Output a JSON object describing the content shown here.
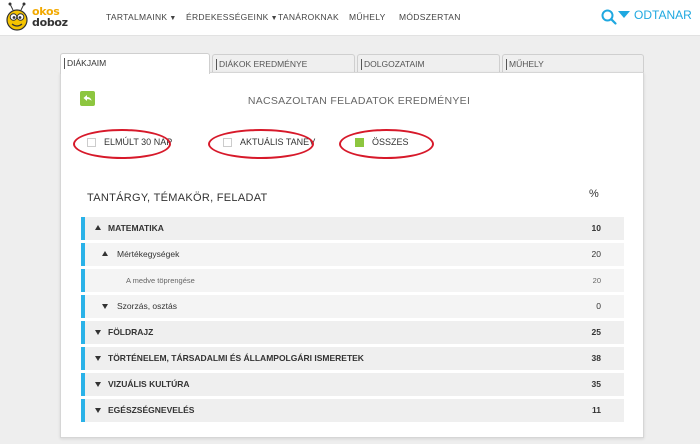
{
  "logo": {
    "line1": "okos",
    "line2": "doboz"
  },
  "nav": [
    {
      "label": "TARTALMAINK",
      "dropdown": true
    },
    {
      "label": "ÉRDEKESSÉGEINK",
      "dropdown": true
    },
    {
      "label": "TANÁROKNAK",
      "dropdown": false
    },
    {
      "label": "MŰHELY",
      "dropdown": false
    },
    {
      "label": "MÓDSZERTAN",
      "dropdown": false
    }
  ],
  "header": {
    "user_label": "ODTANAR"
  },
  "tabs": [
    {
      "label": "DIÁKJAIM",
      "active": true
    },
    {
      "label": "DIÁKOK EREDMÉNYE",
      "active": false
    },
    {
      "label": "DOLGOZATAIM",
      "active": false
    },
    {
      "label": "MŰHELY",
      "active": false
    }
  ],
  "card": {
    "title": "NACSAZOLTAN FELADATOK EREDMÉNYEI"
  },
  "filters": [
    {
      "label": "ELMÚLT 30 NAP",
      "checked": false
    },
    {
      "label": "AKTUÁLIS TANÉV",
      "checked": false
    },
    {
      "label": "ÖSSZES",
      "checked": true
    }
  ],
  "table": {
    "header_label": "TANTÁRGY, TÉMAKÖR, FELADAT",
    "header_value": "%",
    "rows": [
      {
        "label": "MATEMATIKA",
        "value": "10",
        "level": 0,
        "caret": "up"
      },
      {
        "label": "Mértékegységek",
        "value": "20",
        "level": 1,
        "caret": "up"
      },
      {
        "label": "A medve töprengése",
        "value": "20",
        "level": 2,
        "caret": null
      },
      {
        "label": "Szorzás, osztás",
        "value": "0",
        "level": 1,
        "caret": "down"
      },
      {
        "label": "FÖLDRAJZ",
        "value": "25",
        "level": 0,
        "caret": "down"
      },
      {
        "label": "TÖRTÉNELEM, TÁRSADALMI ÉS ÁLLAMPOLGÁRI ISMERETEK",
        "value": "38",
        "level": 0,
        "caret": "down"
      },
      {
        "label": "VIZUÁLIS KULTÚRA",
        "value": "35",
        "level": 0,
        "caret": "down"
      },
      {
        "label": "EGÉSZSÉGNEVELÉS",
        "value": "11",
        "level": 0,
        "caret": "down"
      }
    ]
  },
  "colors": {
    "accent": "#1fa8e0",
    "green": "#8dc63f",
    "highlight_ring": "#d7192a",
    "row_bar": "#2ab2e8"
  }
}
